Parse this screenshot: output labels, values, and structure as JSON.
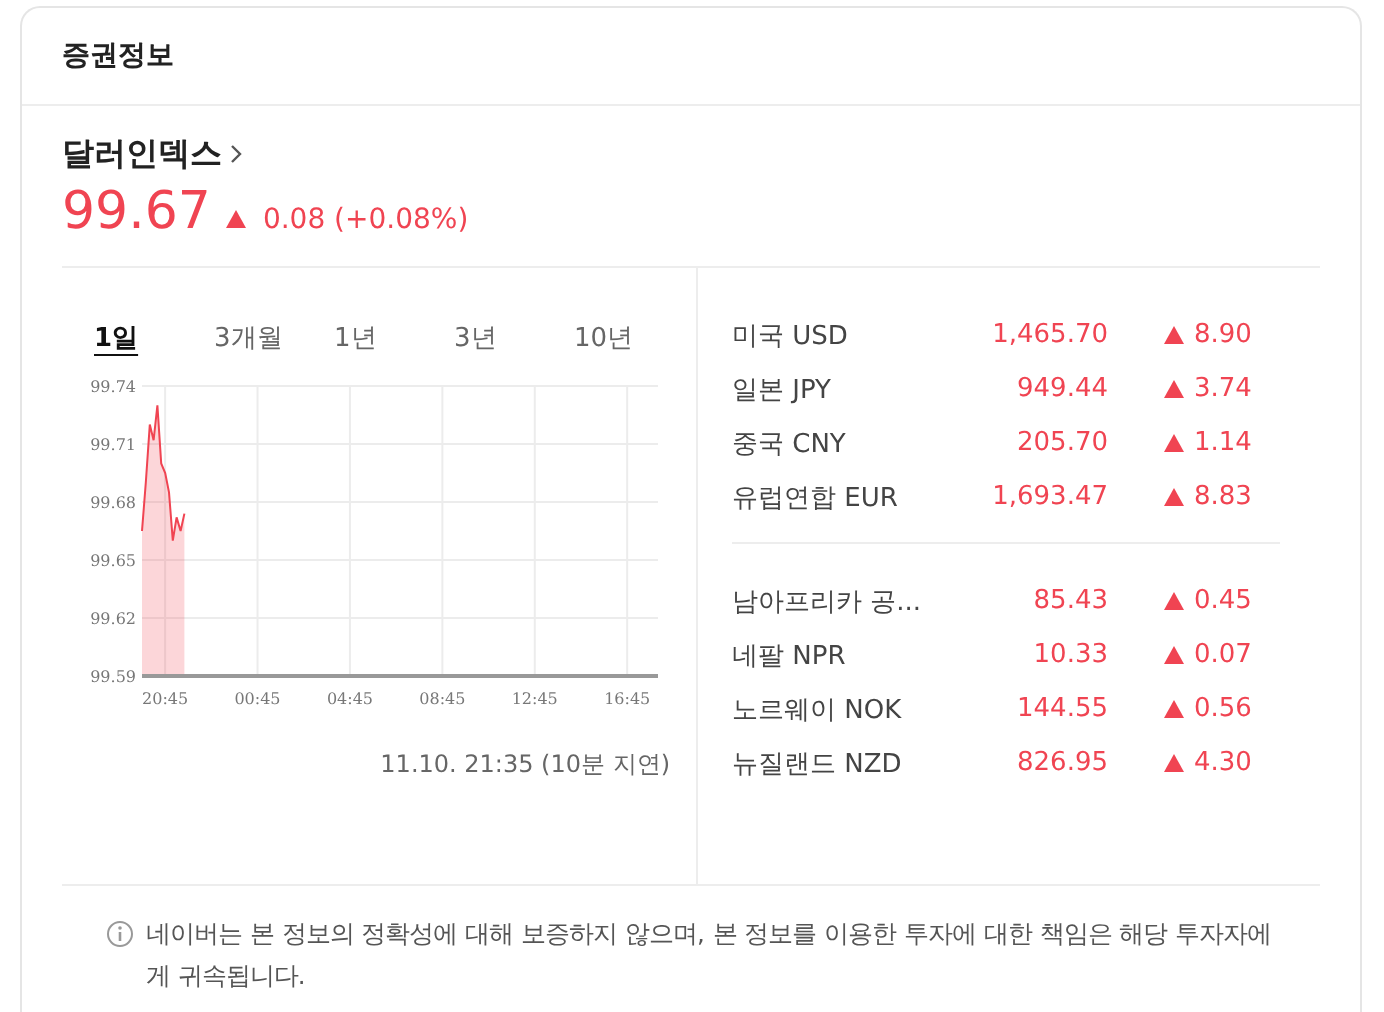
{
  "header": {
    "title": "증권정보"
  },
  "index": {
    "name": "달러인덱스",
    "price": "99.67",
    "rising": true,
    "change": "0.08 (+0.08%)"
  },
  "tabs": [
    {
      "label": "1일",
      "selected": true
    },
    {
      "label": "3개월",
      "selected": false
    },
    {
      "label": "1년",
      "selected": false
    },
    {
      "label": "3년",
      "selected": false
    },
    {
      "label": "10년",
      "selected": false
    }
  ],
  "chart_data": {
    "type": "area",
    "categories": [
      null,
      null,
      null,
      null,
      null,
      null,
      "20:45",
      null,
      null,
      null,
      null,
      null,
      null,
      null,
      null,
      null,
      null,
      null,
      null,
      null,
      null,
      null,
      null,
      null,
      null,
      null,
      null,
      null,
      null,
      null,
      "00:45",
      null,
      null,
      null,
      null,
      null,
      null,
      null,
      null,
      null,
      null,
      null,
      null,
      null,
      null,
      null,
      null,
      null,
      null,
      null,
      null,
      null,
      null,
      null,
      "04:45",
      null,
      null,
      null,
      null,
      null,
      null,
      null,
      null,
      null,
      null,
      null,
      null,
      null,
      null,
      null,
      null,
      null,
      null,
      null,
      null,
      null,
      null,
      null,
      "08:45",
      null,
      null,
      null,
      null,
      null,
      null,
      null,
      null,
      null,
      null,
      null,
      null,
      null,
      null,
      null,
      null,
      null,
      null,
      null,
      null,
      null,
      null,
      null,
      "12:45",
      null,
      null,
      null,
      null,
      null,
      null,
      null,
      null,
      null,
      null,
      null,
      null,
      null,
      null,
      null,
      null,
      null,
      null,
      null,
      null,
      null,
      null,
      null,
      "16:45",
      null,
      null,
      null,
      null,
      null,
      null,
      null,
      null
    ],
    "grid": true,
    "series": [
      {
        "color": "#f04452",
        "values": [
          99.665,
          99.69,
          99.72,
          99.712,
          99.73,
          99.7,
          99.695,
          99.685,
          99.66,
          99.672,
          99.665,
          99.674,
          null,
          null,
          null,
          null,
          null,
          null,
          null,
          null,
          null,
          null,
          null,
          null,
          null,
          null,
          null,
          null,
          null,
          null,
          null,
          null,
          null,
          null,
          null,
          null,
          null,
          null,
          null,
          null,
          null,
          null,
          null,
          null,
          null,
          null,
          null,
          null,
          null,
          null,
          null,
          null,
          null,
          null,
          null,
          null,
          null,
          null,
          null,
          null,
          null,
          null,
          null,
          null,
          null,
          null,
          null,
          null,
          null,
          null,
          null,
          null,
          null,
          null,
          null,
          null,
          null,
          null,
          null,
          null,
          null,
          null,
          null,
          null,
          null,
          null,
          null,
          null,
          null,
          null,
          null,
          null,
          null,
          null,
          null,
          null,
          null,
          null,
          null,
          null,
          null,
          null,
          null,
          null,
          null,
          null,
          null,
          null,
          null,
          null,
          null,
          null,
          null,
          null,
          null,
          null,
          null,
          null,
          null,
          null,
          null,
          null,
          null,
          null,
          null,
          null,
          null,
          null,
          null,
          null,
          null,
          null,
          null,
          null,
          null
        ]
      }
    ],
    "ylim": [
      99.59,
      99.74
    ],
    "yticks": [
      {
        "value": 99.59,
        "label": "99.59"
      },
      {
        "value": 99.62,
        "label": "99.62"
      },
      {
        "value": 99.65,
        "label": "99.65"
      },
      {
        "value": 99.68,
        "label": "99.68"
      },
      {
        "value": 99.71,
        "label": "99.71"
      },
      {
        "value": 99.74,
        "label": "99.74"
      }
    ]
  },
  "timestamp": "11.10. 21:35 (10분 지연)",
  "currency_groups": [
    {
      "rows": [
        {
          "name": "미국 USD",
          "value": "1,465.70",
          "rising": true,
          "change": "8.90"
        },
        {
          "name": "일본 JPY",
          "value": "949.44",
          "rising": true,
          "change": "3.74"
        },
        {
          "name": "중국 CNY",
          "value": "205.70",
          "rising": true,
          "change": "1.14"
        },
        {
          "name": "유럽연합 EUR",
          "value": "1,693.47",
          "rising": true,
          "change": "8.83"
        }
      ]
    },
    {
      "rows": [
        {
          "name": "남아프리카 공...",
          "value": "85.43",
          "rising": true,
          "change": "0.45"
        },
        {
          "name": "네팔 NPR",
          "value": "10.33",
          "rising": true,
          "change": "0.07"
        },
        {
          "name": "노르웨이 NOK",
          "value": "144.55",
          "rising": true,
          "change": "0.56"
        },
        {
          "name": "뉴질랜드 NZD",
          "value": "826.95",
          "rising": true,
          "change": "4.30"
        }
      ]
    }
  ],
  "disclaimer": "네이버는 본 정보의 정확성에 대해 보증하지 않으며, 본 정보를 이용한 투자에 대한 책임은 해당 투자자에게 귀속됩니다."
}
